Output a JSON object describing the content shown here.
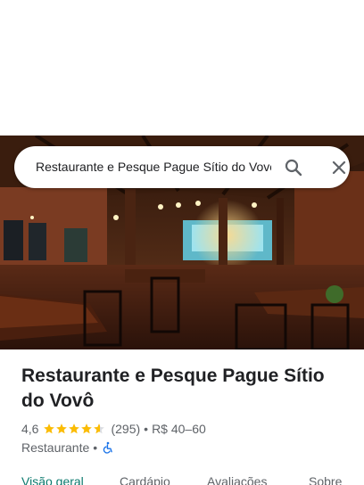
{
  "search": {
    "query": "Restaurante e Pesque Pague Sítio do Vovô"
  },
  "place": {
    "name": "Restaurante e Pesque Pague Sítio do Vovô",
    "rating": "4,6",
    "stars": 4.6,
    "reviews": "(295)",
    "separator": "•",
    "price": "R$ 40–60",
    "category": "Restaurante",
    "category_separator": "•",
    "accessibility_icon": "wheelchair-icon"
  },
  "tabs": [
    {
      "label": "Visão geral",
      "active": true
    },
    {
      "label": "Cardápio",
      "active": false
    },
    {
      "label": "Avaliações",
      "active": false
    },
    {
      "label": "Sobre",
      "active": false
    }
  ],
  "colors": {
    "star": "#fbbc04",
    "accent": "#0b7a6e",
    "accessibility": "#1a73e8"
  }
}
